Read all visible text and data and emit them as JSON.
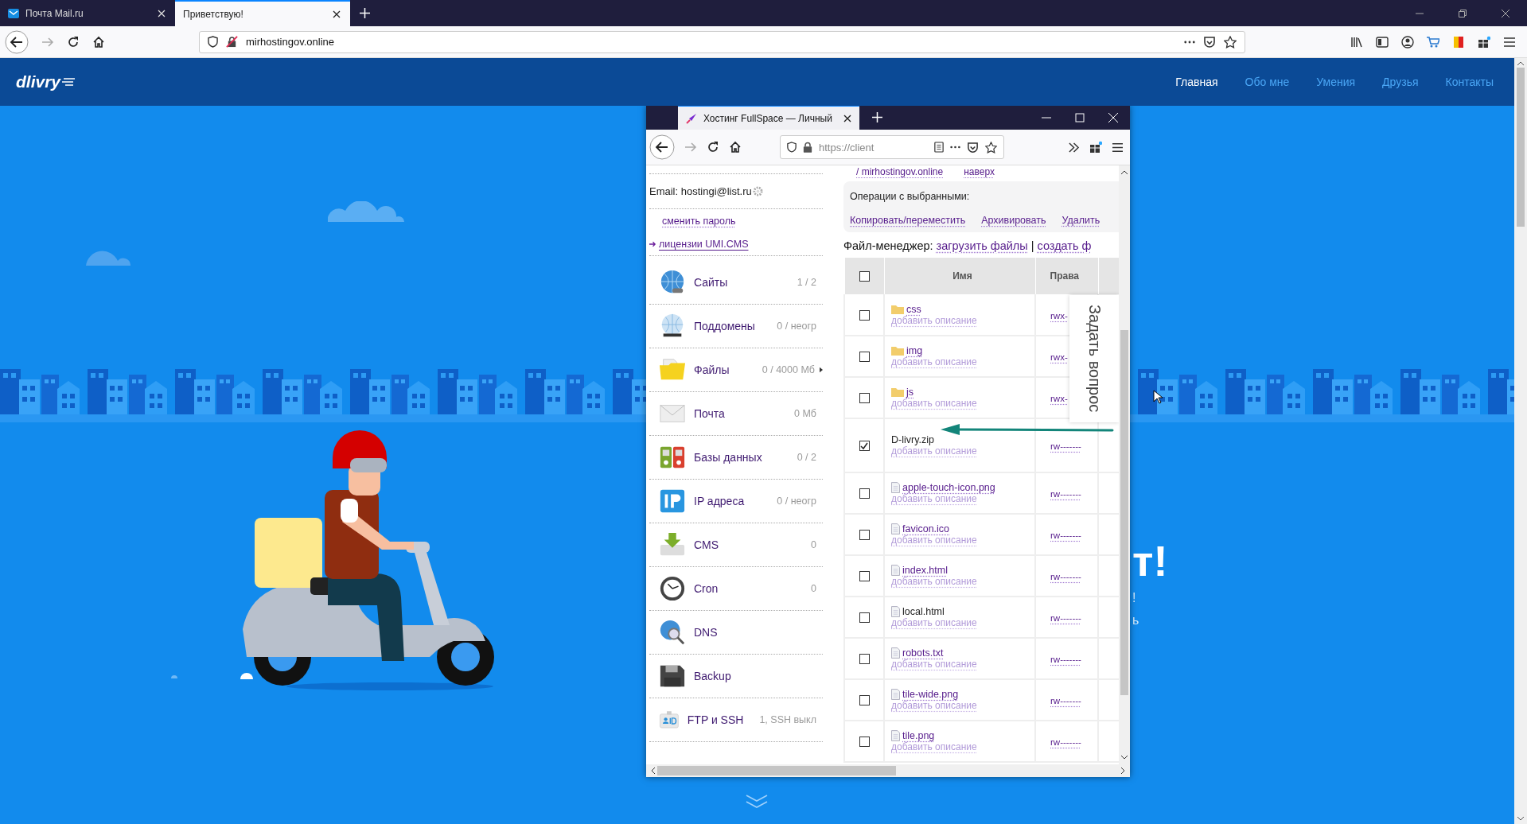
{
  "browser": {
    "tabs": [
      {
        "title": "Почта Mail.ru",
        "favicon": true,
        "selected": false
      },
      {
        "title": "Приветствую!",
        "favicon": false,
        "selected": true
      }
    ],
    "url": "mirhostingov.online"
  },
  "site": {
    "logo": "dlivry",
    "nav": [
      {
        "label": "Главная",
        "selected": true
      },
      {
        "label": "Обо мне",
        "selected": false
      },
      {
        "label": "Умения",
        "selected": false
      },
      {
        "label": "Друзья",
        "selected": false
      },
      {
        "label": "Контакты",
        "selected": false
      }
    ],
    "hero_fragments": [
      "т!",
      "!",
      "ь"
    ]
  },
  "popup": {
    "tab_title": "Хостинг FullSpace — Личный",
    "url": "https://client",
    "email": "Email: hostingi@list.ru",
    "links": [
      {
        "label": "сменить пароль",
        "arrow": false
      },
      {
        "label": "лицензии UMI.CMS",
        "arrow": true
      }
    ],
    "menu": [
      {
        "label": "Сайты",
        "count": "1 / 2",
        "expandable": false
      },
      {
        "label": "Поддомены",
        "count": "0 / неогр",
        "expandable": false
      },
      {
        "label": "Файлы",
        "count": "0 / 4000 Мб",
        "expandable": true
      },
      {
        "label": "Почта",
        "count": "0 Мб",
        "expandable": false
      },
      {
        "label": "Базы данных",
        "count": "0 / 2",
        "expandable": false
      },
      {
        "label": "IP адреса",
        "count": "0 / неогр",
        "expandable": false
      },
      {
        "label": "CMS",
        "count": "0",
        "expandable": false
      },
      {
        "label": "Cron",
        "count": "0",
        "expandable": false
      },
      {
        "label": "DNS",
        "expandable": false
      },
      {
        "label": "Backup",
        "expandable": false
      },
      {
        "label": "FTP и SSH",
        "count": "1, SSH выкл",
        "expandable": false
      }
    ],
    "breadcrumb": {
      "path": "/ mirhostingov.online",
      "up": "наверх"
    },
    "operations": {
      "title": "Операции с выбранными:",
      "actions": [
        "Копировать/переместить",
        "Архивировать",
        "Удалить"
      ]
    },
    "file_manager": {
      "label": "Файл-менеджер:",
      "links": [
        "загрузить файлы",
        "создать ф"
      ],
      "separator": "|"
    },
    "table": {
      "select_all": {
        "checked": false
      },
      "columns": [
        "Имя",
        "Права"
      ],
      "rows": [
        {
          "kind": "folder",
          "name": "css",
          "linked": true,
          "checked": false,
          "description": "добавить описание",
          "rights": "rwx-"
        },
        {
          "kind": "folder",
          "name": "img",
          "linked": true,
          "checked": false,
          "description": "добавить описание",
          "rights": "rwx-"
        },
        {
          "kind": "folder",
          "name": "js",
          "linked": true,
          "checked": false,
          "description": "добавить описание",
          "rights": "rwx-"
        },
        {
          "kind": "archive",
          "name": "D-livry.zip",
          "linked": false,
          "checked": true,
          "description": "добавить описание",
          "rights": "rw-------"
        },
        {
          "kind": "file",
          "name": "apple-touch-icon.png",
          "linked": true,
          "checked": false,
          "description": "добавить описание",
          "rights": "rw-------"
        },
        {
          "kind": "file",
          "name": "favicon.ico",
          "linked": true,
          "checked": false,
          "description": "добавить описание",
          "rights": "rw-------"
        },
        {
          "kind": "file",
          "name": "index.html",
          "linked": true,
          "checked": false,
          "description": "добавить описание",
          "rights": "rw-------"
        },
        {
          "kind": "file",
          "name": "local.html",
          "linked": false,
          "checked": false,
          "description": "добавить описание",
          "rights": "rw-------"
        },
        {
          "kind": "file",
          "name": "robots.txt",
          "linked": true,
          "checked": false,
          "description": "добавить описание",
          "rights": "rw-------"
        },
        {
          "kind": "file",
          "name": "tile-wide.png",
          "linked": true,
          "checked": false,
          "description": "добавить описание",
          "rights": "rw-------"
        },
        {
          "kind": "file",
          "name": "tile.png",
          "linked": true,
          "checked": false,
          "description": "добавить описание",
          "rights": "rw-------"
        }
      ]
    },
    "ask_tab": "Задать вопрос"
  }
}
